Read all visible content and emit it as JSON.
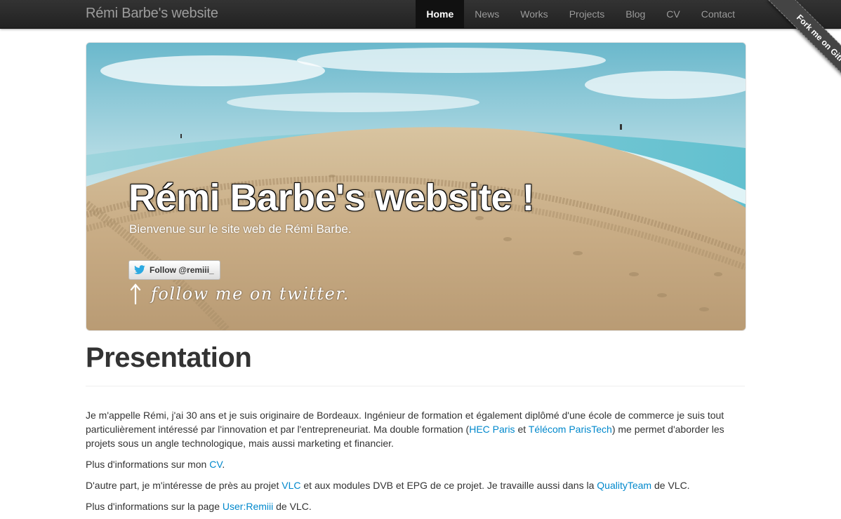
{
  "navbar": {
    "brand": "Rémi Barbe's website",
    "items": [
      {
        "label": "Home",
        "active": true
      },
      {
        "label": "News"
      },
      {
        "label": "Works"
      },
      {
        "label": "Projects"
      },
      {
        "label": "Blog"
      },
      {
        "label": "CV"
      },
      {
        "label": "Contact"
      }
    ]
  },
  "ribbon": {
    "label": "Fork me on GitHub"
  },
  "hero": {
    "title": "Rémi Barbe's website !",
    "subtitle": "Bienvenue sur le site web de Rémi Barbe.",
    "follow_button": "Follow @remiii_",
    "follow_note": "follow me on twitter.",
    "follow_icon": "twitter-bird-icon",
    "arrow_icon": "arrow-up-icon"
  },
  "content": {
    "title": "Presentation",
    "p1": {
      "before": "Je m'appelle Rémi, j'ai 30 ans et je suis originaire de Bordeaux. Ingénieur de formation et également diplômé d'une école de commerce je suis tout particulièrement intéressé par l'innovation et par l'entrepreneuriat. Ma double formation (",
      "link1": "HEC Paris",
      "mid": " et ",
      "link2": "Télécom ParisTech",
      "after": ") me permet d'aborder les projets sous un angle technologique, mais aussi marketing et financier."
    },
    "p2": {
      "before": "Plus d'informations sur mon ",
      "link": "CV",
      "after": "."
    },
    "p3": {
      "before": "D'autre part, je m'intéresse de près au projet ",
      "link1": "VLC",
      "mid": " et aux modules DVB et EPG de ce projet. Je travaille aussi dans la ",
      "link2": "QualityTeam",
      "after": " de VLC."
    },
    "p4": {
      "before": "Plus d'informations sur la page ",
      "link": "User:Remiii",
      "after": " de VLC."
    }
  },
  "colors": {
    "navbar": "#222222",
    "link": "#0088cc",
    "text": "#333333",
    "active_nav": "#111111"
  }
}
